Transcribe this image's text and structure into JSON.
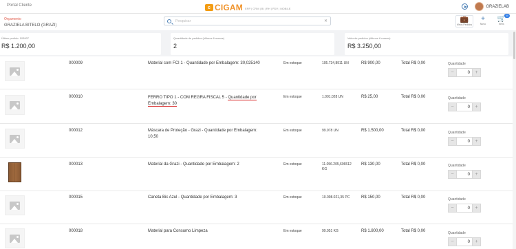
{
  "topbar": {
    "portal_title": "Portal Cliente",
    "logo_text": "CIGAM",
    "logo_sub": "ERP | CRM | BI | RH | PDV | MOBILE",
    "user_name": "GRAZIELAB"
  },
  "subheader": {
    "section_label": "Orçamento",
    "client_name": "GRAZIELA BITELO (GRAZI)",
    "search_placeholder": "Pesquisar",
    "actions": [
      {
        "label": "Meus Pedidos",
        "icon": "bag-icon"
      },
      {
        "label": "Novo",
        "icon": "plus-icon"
      },
      {
        "label": "Itens",
        "icon": "cart-icon",
        "badge": "00"
      }
    ]
  },
  "stats": [
    {
      "title": "Último pedido: 103907",
      "value": "R$ 1.200,00"
    },
    {
      "title": "Quantidade de pedidos (últimos 6 meses)",
      "value": "2"
    },
    {
      "title": "Valor de pedidos (últimos 6 meses)",
      "value": "R$ 3.250,00"
    }
  ],
  "quantity_label": "Quantidade",
  "products": [
    {
      "code": "000009",
      "description": "Material com FCI 1 - Quantidade por Embalagem: 30,025140",
      "stock": "Em estoque",
      "available": "105.734,8911 UN",
      "price": "R$ 900,00",
      "total": "Total R$ 0,00",
      "qty": "0",
      "image": "placeholder"
    },
    {
      "code": "000010",
      "description_main": "FERRO TIPO 1 - COM REGRA FISCAL 5 - ",
      "description_underlined": "Quantidade por Embalagem: 30",
      "stock": "Em estoque",
      "available": "1.001.028 UN",
      "price": "R$ 25,00",
      "total": "Total R$ 0,00",
      "qty": "0",
      "image": "placeholder"
    },
    {
      "code": "000012",
      "description": "Máscara de Proteção - Grazi - Quantidade por Embalagem: 10,50",
      "stock": "Em estoque",
      "available": "99.978 UN",
      "price": "R$ 1.500,00",
      "total": "Total R$ 0,00",
      "qty": "0",
      "image": "placeholder"
    },
    {
      "code": "000013",
      "description": "Material da Grazi - Quantidade por Embalagem: 2",
      "stock": "Em estoque",
      "available": "11.056.205,606512 KG",
      "price": "R$ 130,00",
      "total": "Total R$ 0,00",
      "qty": "0",
      "image": "wardrobe"
    },
    {
      "code": "000015",
      "description": "Caneta Bic Azul - Quantidade por Embalagem: 3",
      "stock": "Em estoque",
      "available": "10.098.021,35 PC",
      "price": "R$ 150,00",
      "total": "Total R$ 0,00",
      "qty": "0",
      "image": "placeholder"
    },
    {
      "code": "000018",
      "description": "Material para Consumo Limpeza",
      "stock": "Em estoque",
      "available": "99.951 KG",
      "price": "R$ 1.800,00",
      "total": "Total R$ 0,00",
      "qty": "0",
      "image": "placeholder"
    }
  ]
}
